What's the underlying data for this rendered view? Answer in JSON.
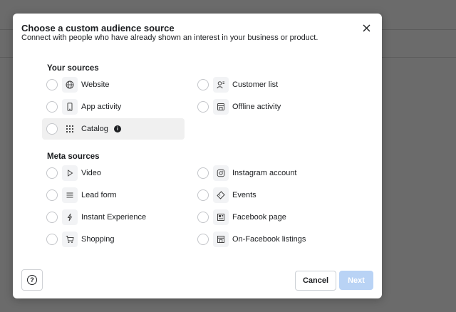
{
  "modal": {
    "title": "Choose a custom audience source",
    "subtitle": "Connect with people who have already shown an interest in your business or product."
  },
  "your_sources": {
    "heading": "Your sources",
    "items": [
      {
        "label": "Website",
        "icon": "globe-icon"
      },
      {
        "label": "Customer list",
        "icon": "customer-list-icon"
      },
      {
        "label": "App activity",
        "icon": "mobile-phone-icon"
      },
      {
        "label": "Offline activity",
        "icon": "store-icon"
      },
      {
        "label": "Catalog",
        "icon": "grid-icon",
        "info": "i",
        "highlighted": true
      }
    ]
  },
  "meta_sources": {
    "heading": "Meta sources",
    "items": [
      {
        "label": "Video",
        "icon": "play-icon"
      },
      {
        "label": "Instagram account",
        "icon": "instagram-icon"
      },
      {
        "label": "Lead form",
        "icon": "lines-icon"
      },
      {
        "label": "Events",
        "icon": "ticket-icon"
      },
      {
        "label": "Instant Experience",
        "icon": "lightning-icon"
      },
      {
        "label": "Facebook page",
        "icon": "page-icon"
      },
      {
        "label": "Shopping",
        "icon": "cart-icon"
      },
      {
        "label": "On-Facebook listings",
        "icon": "storefront-icon"
      }
    ]
  },
  "footer": {
    "help_icon": "?",
    "cancel_label": "Cancel",
    "next_label": "Next"
  },
  "colors": {
    "overlay": "#6b6b6b",
    "next_disabled": "#b9d3f5",
    "highlight": "#f0f0f0"
  }
}
